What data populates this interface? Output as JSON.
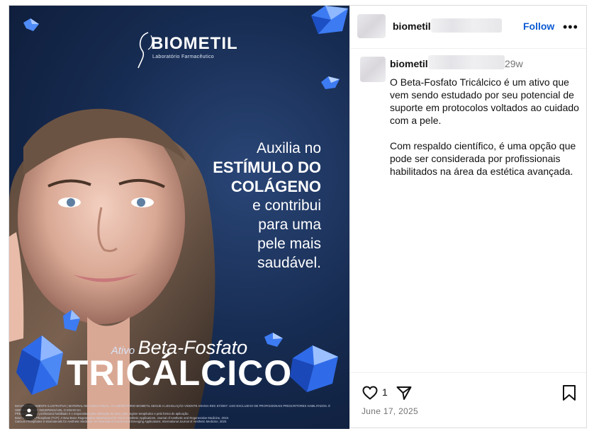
{
  "post": {
    "brand": "BIOMETIL",
    "brand_sub": "Laboratório Farmacêutico",
    "headline_1": "Auxilia no",
    "headline_2": "ESTÍMULO DO",
    "headline_3": "COLÁGENO",
    "headline_4": "e contribui",
    "headline_5": "para uma",
    "headline_6": "pele mais",
    "headline_7": "saudável.",
    "active_label": "Ativo",
    "active_name": "Beta-Fosfato",
    "big_title": "TRICÁLCICO",
    "fineprint_1": "IMAGEM MERAMENTE ILUSTRATIVA | MATERIAL DE AJUDA VISUAL. O LABORATÓRIO BIOMETIL SEGUE A LEGISLAÇÃO VIGENTE ANVISA RDC 67/2007. USO EXCLUSIVO DE PROFISSIONAIS PRESCRITORES HABILITADOS. É OBRIGATÓRIO E INDISPENSÁVEL O ENVIO DA",
    "fineprint_2": "PRESCRIÇÃO. O profissional habilitado é o responsável pela indicação do ativo, pelo regime terapêutico e pela forma de aplicação.",
    "fineprint_3": "Beta-Tricalcium Phosphate (TCP): A New Bone Regenerative Material and Its Use in Aesthetic Applications. Journal of Aesthetic and Regenerative Medicine, 2019.",
    "fineprint_4": "Calcium Phosphates in Biomaterials for Aesthetic Medicine: An Overview of Current and Emerging Applications. International Journal of Aesthetic Medicine, 2020."
  },
  "header": {
    "username": "biometil",
    "follow_label": "Follow",
    "more_label": "•••"
  },
  "caption": {
    "username": "biometil",
    "time": "29w",
    "paragraph_1": "O Beta-Fosfato Tricálcico é um ativo que vem sendo estudado por seu potencial de suporte em protocolos voltados ao cuidado com a pele.",
    "paragraph_2": "Com respaldo científico, é uma opção que pode ser considerada por profissionais habilitados na área da estética avançada."
  },
  "actions": {
    "like_count": "1",
    "date": "June 17, 2025"
  },
  "icons": {
    "like": "heart-icon",
    "share": "paper-plane-icon",
    "save": "bookmark-icon",
    "more": "ellipsis-icon",
    "tag": "user-tag-icon"
  },
  "colors": {
    "follow": "#0b5bd3",
    "muted": "#737373",
    "ad_background": "#172c52",
    "crystal": "#3d7bf2"
  }
}
